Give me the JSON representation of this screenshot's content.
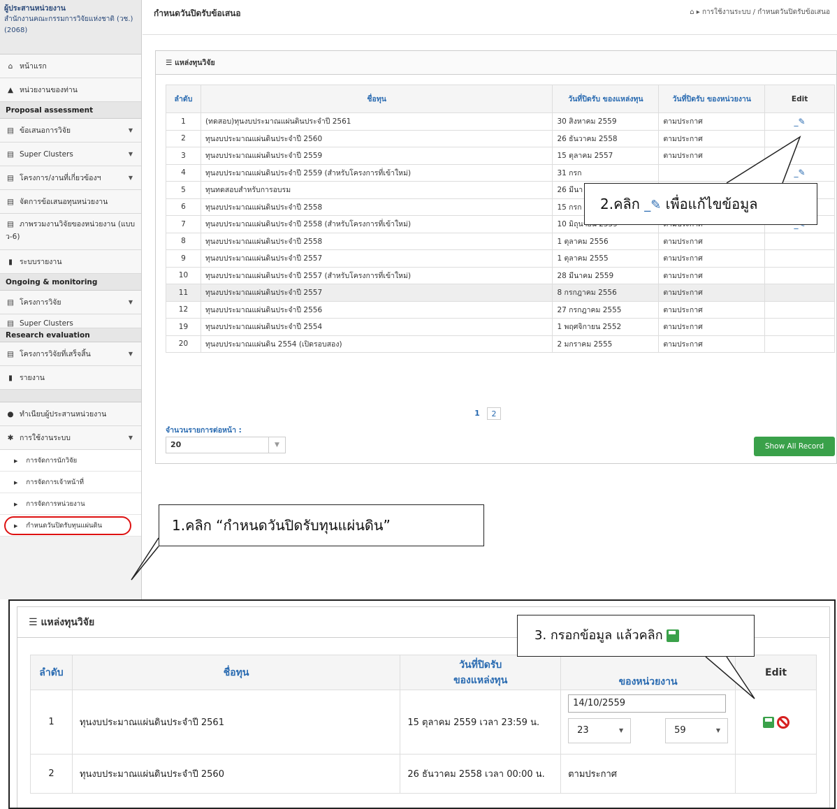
{
  "sidebar": {
    "header_title": "ผู้ประสานหน่วยงาน",
    "header_org": "สำนักงานคณะกรรมการวิจัยแห่งชาติ (วช.)(2068)",
    "home": "หน้าแรก",
    "my_unit": "หน่วยงานของท่าน",
    "section_proposal": "Proposal assessment",
    "proposal": "ข้อเสนอการวิจัย",
    "super_clusters": "Super Clusters",
    "related": "โครงการ/งานที่เกี่ยวข้องฯ",
    "manage_fund": "จัดการข้อเสนอทุนหน่วยงาน",
    "overview": "ภาพรวมงานวิจัยของหน่วยงาน (แบบ ว-6)",
    "report_system": "ระบบรายงาน",
    "section_ongoing": "Ongoing & monitoring",
    "research_project": "โครงการวิจัย",
    "super_clusters_2": "Super Clusters",
    "section_eval": "Research evaluation",
    "finished": "โครงการวิจัยที่เสร็จสิ้น",
    "report": "รายงาน",
    "register": "ทำเนียบผู้ประสานหน่วยงาน",
    "usage": "การใช้งานระบบ",
    "sub1": "การจัดการนักวิจัย",
    "sub2": "การจัดการเจ้าหน้าที่",
    "sub3": "การจัดการหน่วยงาน",
    "sub4": "กำหนดวันปิดรับทุนแผ่นดิน"
  },
  "main": {
    "title": "กำหนดวันปิดรับข้อเสนอ",
    "breadcrumb": "การใช้งานระบบ / กำหนดวันปิดรับข้อเสนอ",
    "panel_title": "แหล่งทุนวิจัย",
    "columns": [
      "ลำดับ",
      "ชื่อทุน",
      "วันที่ปิดรับ ของแหล่งทุน",
      "วันที่ปิดรับ ของหน่วยงาน",
      "Edit"
    ],
    "rows": [
      [
        "1",
        "(ทดสอบ)ทุนงบประมาณแผ่นดินประจำปี 2561",
        "30 สิงหาคม 2559",
        "ตามประกาศ"
      ],
      [
        "2",
        "ทุนงบประมาณแผ่นดินประจำปี 2560",
        "26 ธันวาคม 2558",
        "ตามประกาศ"
      ],
      [
        "3",
        "ทุนงบประมาณแผ่นดินประจำปี 2559",
        "15 ตุลาคม 2557",
        "ตามประกาศ"
      ],
      [
        "4",
        "ทุนงบประมาณแผ่นดินประจำปี 2559 (สำหรับโครงการที่เข้าใหม่)",
        "31 กรก",
        ""
      ],
      [
        "5",
        "ทุนทดสอบสำหรับการอบรม",
        "26 มีนา",
        ""
      ],
      [
        "6",
        "ทุนงบประมาณแผ่นดินประจำปี 2558",
        "15 กรก",
        ""
      ],
      [
        "7",
        "ทุนงบประมาณแผ่นดินประจำปี 2558 (สำหรับโครงการที่เข้าใหม่)",
        "10 มิถุนายน 2559",
        "ตามประกาศ"
      ],
      [
        "8",
        "ทุนงบประมาณแผ่นดินประจำปี 2558",
        "1 ตุลาคม 2556",
        "ตามประกาศ"
      ],
      [
        "9",
        "ทุนงบประมาณแผ่นดินประจำปี 2557",
        "1 ตุลาคม 2555",
        "ตามประกาศ"
      ],
      [
        "10",
        "ทุนงบประมาณแผ่นดินประจำปี 2557 (สำหรับโครงการที่เข้าใหม่)",
        "28 มีนาคม 2559",
        "ตามประกาศ"
      ],
      [
        "11",
        "ทุนงบประมาณแผ่นดินประจำปี 2557",
        "8 กรกฎาคม 2556",
        "ตามประกาศ"
      ],
      [
        "12",
        "ทุนงบประมาณแผ่นดินประจำปี 2556",
        "27 กรกฎาคม 2555",
        "ตามประกาศ"
      ],
      [
        "19",
        "ทุนงบประมาณแผ่นดินประจำปี 2554",
        "1 พฤศจิกายน 2552",
        "ตามประกาศ"
      ],
      [
        "20",
        "ทุนงบประมาณแผ่นดิน 2554 (เปิดรอบสอง)",
        "2 มกราคม 2555",
        "ตามประกาศ"
      ]
    ],
    "edit_rows": [
      0,
      3,
      6
    ],
    "pages": [
      "1",
      "2"
    ],
    "per_page_label": "จำนวนรายการต่อหน้า :",
    "per_page_value": "20",
    "show_all": "Show All Record"
  },
  "callouts": {
    "c1": "1.คลิก  “กำหนดวันปิดรับทุนแผ่นดิน”",
    "c2_pre": "2.คลิก",
    "c2_post": "เพื่อแก้ไขข้อมูล",
    "c3": "3. กรอกข้อมูล แล้วคลิก"
  },
  "bottom": {
    "panel_title": "แหล่งทุนวิจัย",
    "col_no": "ลำดับ",
    "col_name": "ชื่อทุน",
    "col_close_fund_1": "วันที่ปิดรับ",
    "col_close_fund_2": "ของแหล่งทุน",
    "col_close_unit": "ของหน่วยงาน",
    "col_edit": "Edit",
    "r1_no": "1",
    "r1_name": "ทุนงบประมาณแผ่นดินประจำปี 2561",
    "r1_date": "15 ตุลาคม 2559 เวลา 23:59 น.",
    "r1_input": "14/10/2559",
    "r1_hour": "23",
    "r1_min": "59",
    "r2_no": "2",
    "r2_name": "ทุนงบประมาณแผ่นดินประจำปี 2560",
    "r2_date": "26 ธันวาคม 2558 เวลา 00:00 น.",
    "r2_unit": "ตามประกาศ"
  }
}
